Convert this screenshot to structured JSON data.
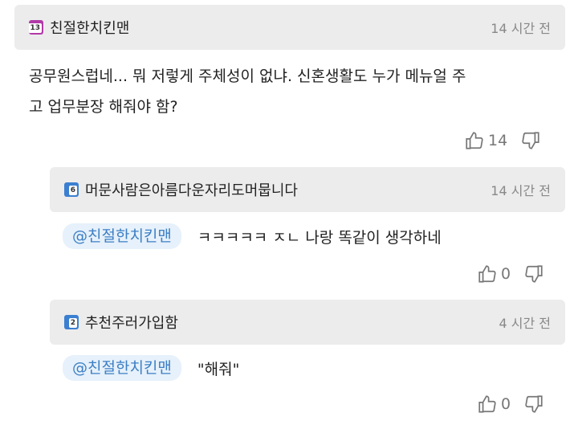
{
  "comments": [
    {
      "level_badge": "13",
      "badge_color": "#b23aa8",
      "author": "친절한치킨맨",
      "time": "14 시간 전",
      "text_line1": "공무원스럽네... 뭐 저렇게 주체성이 없냐. 신혼생활도 누가 메뉴얼 주",
      "text_line2": "고 업무분장 해줘야 함?",
      "likes": "14"
    },
    {
      "level_badge": "6",
      "badge_color": "#3b7fd1",
      "author": "머문사람은아름다운자리도머뭅니다",
      "time": "14 시간 전",
      "mention": "@친절한치킨맨",
      "text": "ㅋㅋㅋㅋㅋ ㅈㄴ 나랑 똑같이 생각하네",
      "likes": "0"
    },
    {
      "level_badge": "2",
      "badge_color": "#3b7fd1",
      "author": "추천주러가입함",
      "time": "4 시간 전",
      "mention": "@친절한치킨맨",
      "text": "\"해줘\"",
      "likes": "0"
    }
  ]
}
